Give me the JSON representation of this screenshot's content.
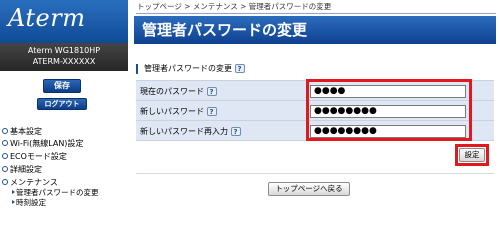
{
  "sidebar": {
    "logo": "Aterm",
    "model": "Aterm WG1810HP",
    "serial": "ATERM-XXXXXX",
    "save_label": "保存",
    "logout_label": "ログアウト",
    "menu": [
      {
        "label": "基本設定"
      },
      {
        "label": "Wi-Fi(無線LAN)設定"
      },
      {
        "label": "ECOモード設定"
      },
      {
        "label": "詳細設定"
      },
      {
        "label": "メンテナンス"
      }
    ],
    "submenu": [
      {
        "label": "管理者パスワードの変更"
      },
      {
        "label": "時刻設定"
      }
    ]
  },
  "breadcrumb": "トップページ > メンテナンス > 管理者パスワードの変更",
  "page_title": "管理者パスワードの変更",
  "section": {
    "heading": "管理者パスワードの変更",
    "help": "?"
  },
  "form": {
    "rows": [
      {
        "label": "現在のパスワード",
        "value": "●●●●"
      },
      {
        "label": "新しいパスワード",
        "value": "●●●●●●●●"
      },
      {
        "label": "新しいパスワード再入力",
        "value": "●●●●●●●●"
      }
    ],
    "submit_label": "設定"
  },
  "back_label": "トップページへ戻る",
  "colors": {
    "brand_blue": "#0e418f",
    "highlight_red": "#e1191f",
    "row_bg": "#dfe7f4"
  }
}
